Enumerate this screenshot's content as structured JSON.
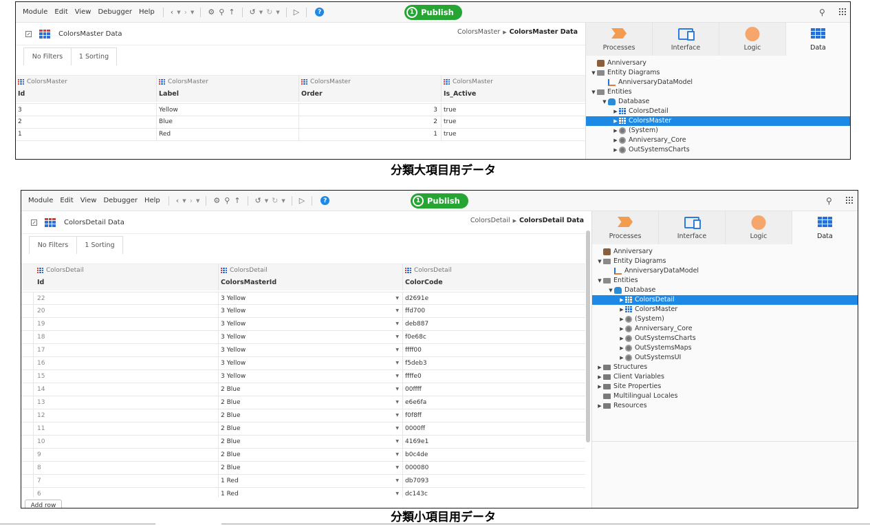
{
  "toolbar": {
    "menu": [
      "Module",
      "Edit",
      "View",
      "Debugger",
      "Help"
    ],
    "publish_number": "1",
    "publish_label": "Publish",
    "icons": [
      "back-icon",
      "forward-icon",
      "gear-icon",
      "plug-icon",
      "merge-icon",
      "undo-icon",
      "redo-icon",
      "megaphone-icon",
      "help-icon",
      "search-icon",
      "apps-grid-icon"
    ]
  },
  "right_panel": {
    "tabs": [
      "Processes",
      "Interface",
      "Logic",
      "Data"
    ],
    "active_tab": "Data"
  },
  "screen1": {
    "title": "ColorsMaster Data",
    "breadcrumb_parent": "ColorsMaster",
    "breadcrumb_current": "ColorsMaster Data",
    "filters": [
      "No Filters",
      "1 Sorting"
    ],
    "columns": [
      {
        "entity": "ColorsMaster",
        "name": "Id"
      },
      {
        "entity": "ColorsMaster",
        "name": "Label"
      },
      {
        "entity": "ColorsMaster",
        "name": "Order"
      },
      {
        "entity": "ColorsMaster",
        "name": "Is_Active"
      }
    ],
    "rows": [
      [
        "3",
        "Yellow",
        "3",
        "true"
      ],
      [
        "2",
        "Blue",
        "2",
        "true"
      ],
      [
        "1",
        "Red",
        "1",
        "true"
      ]
    ],
    "tree": [
      {
        "label": "Anniversary",
        "icon": "app-icon",
        "level": 0,
        "arrow": ""
      },
      {
        "label": "Entity Diagrams",
        "icon": "folder-open-icon",
        "level": 0,
        "arrow": "down"
      },
      {
        "label": "AnniversaryDataModel",
        "icon": "diagram-icon",
        "level": 1,
        "arrow": ""
      },
      {
        "label": "Entities",
        "icon": "folder-open-icon",
        "level": 0,
        "arrow": "down"
      },
      {
        "label": "Database",
        "icon": "database-icon",
        "level": 1,
        "arrow": "down"
      },
      {
        "label": "ColorsDetail",
        "icon": "entity-icon",
        "level": 2,
        "arrow": "right"
      },
      {
        "label": "ColorsMaster",
        "icon": "entity-icon",
        "level": 2,
        "arrow": "right",
        "selected": true
      },
      {
        "label": "(System)",
        "icon": "module-icon",
        "level": 2,
        "arrow": "right"
      },
      {
        "label": "Anniversary_Core",
        "icon": "module-icon",
        "level": 2,
        "arrow": "right"
      },
      {
        "label": "OutSystemsCharts",
        "icon": "module-icon",
        "level": 2,
        "arrow": "right"
      }
    ],
    "caption": "分類大項目用データ"
  },
  "screen2": {
    "title": "ColorsDetail Data",
    "breadcrumb_parent": "ColorsDetail",
    "breadcrumb_current": "ColorsDetail Data",
    "filters": [
      "No Filters",
      "1 Sorting"
    ],
    "columns": [
      {
        "entity": "ColorsDetail",
        "name": "Id"
      },
      {
        "entity": "ColorsDetail",
        "name": "ColorsMasterId"
      },
      {
        "entity": "ColorsDetail",
        "name": "ColorCode"
      }
    ],
    "rows": [
      [
        "22",
        "3 Yellow",
        "d2691e"
      ],
      [
        "20",
        "3 Yellow",
        "ffd700"
      ],
      [
        "19",
        "3 Yellow",
        "deb887"
      ],
      [
        "18",
        "3 Yellow",
        "f0e68c"
      ],
      [
        "17",
        "3 Yellow",
        "ffff00"
      ],
      [
        "16",
        "3 Yellow",
        "f5deb3"
      ],
      [
        "15",
        "3 Yellow",
        "ffffe0"
      ],
      [
        "14",
        "2 Blue",
        "00ffff"
      ],
      [
        "13",
        "2 Blue",
        "e6e6fa"
      ],
      [
        "12",
        "2 Blue",
        "f0f8ff"
      ],
      [
        "11",
        "2 Blue",
        "0000ff"
      ],
      [
        "10",
        "2 Blue",
        "4169e1"
      ],
      [
        "9",
        "2 Blue",
        "b0c4de"
      ],
      [
        "8",
        "2 Blue",
        "000080"
      ],
      [
        "7",
        "1 Red",
        "db7093"
      ],
      [
        "6",
        "1 Red",
        "dc143c"
      ]
    ],
    "add_row": "Add row",
    "tree": [
      {
        "label": "Anniversary",
        "icon": "app-icon",
        "level": 0,
        "arrow": ""
      },
      {
        "label": "Entity Diagrams",
        "icon": "folder-open-icon",
        "level": 0,
        "arrow": "down"
      },
      {
        "label": "AnniversaryDataModel",
        "icon": "diagram-icon",
        "level": 1,
        "arrow": ""
      },
      {
        "label": "Entities",
        "icon": "folder-open-icon",
        "level": 0,
        "arrow": "down"
      },
      {
        "label": "Database",
        "icon": "database-icon",
        "level": 1,
        "arrow": "down"
      },
      {
        "label": "ColorsDetail",
        "icon": "entity-icon",
        "level": 2,
        "arrow": "right",
        "selected": true
      },
      {
        "label": "ColorsMaster",
        "icon": "entity-icon",
        "level": 2,
        "arrow": "right"
      },
      {
        "label": "(System)",
        "icon": "module-icon",
        "level": 2,
        "arrow": "right"
      },
      {
        "label": "Anniversary_Core",
        "icon": "module-icon",
        "level": 2,
        "arrow": "right"
      },
      {
        "label": "OutSystemsCharts",
        "icon": "module-icon",
        "level": 2,
        "arrow": "right"
      },
      {
        "label": "OutSystemsMaps",
        "icon": "module-icon",
        "level": 2,
        "arrow": "right"
      },
      {
        "label": "OutSystemsUI",
        "icon": "module-icon",
        "level": 2,
        "arrow": "right"
      },
      {
        "label": "Structures",
        "icon": "folder-icon",
        "level": 0,
        "arrow": "right"
      },
      {
        "label": "Client Variables",
        "icon": "folder-icon",
        "level": 0,
        "arrow": "right"
      },
      {
        "label": "Site Properties",
        "icon": "folder-icon",
        "level": 0,
        "arrow": "right"
      },
      {
        "label": "Multilingual Locales",
        "icon": "folder-icon",
        "level": 0,
        "arrow": ""
      },
      {
        "label": "Resources",
        "icon": "folder-icon",
        "level": 0,
        "arrow": "right"
      }
    ],
    "caption": "分類小項目用データ"
  },
  "colors": {
    "publish_green": "#27a534",
    "selection_blue": "#1e88e5",
    "entity_blue": "#2a6fd6"
  }
}
